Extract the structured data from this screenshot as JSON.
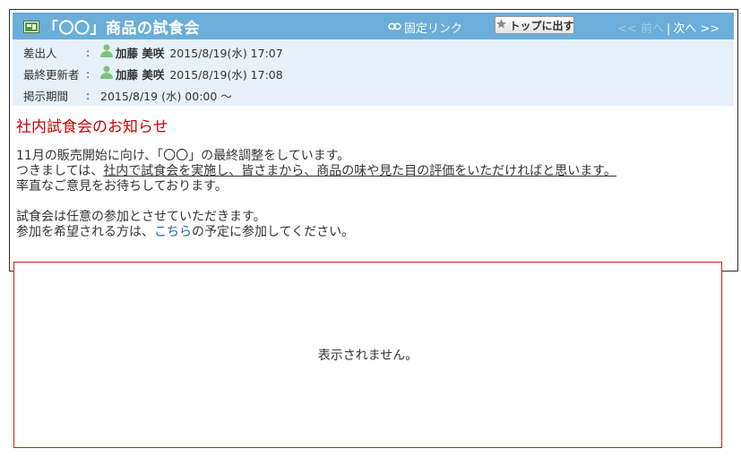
{
  "title_bar": {
    "title": "「〇〇」商品の試食会",
    "permalink_label": "固定リンク",
    "top_button_label": "トップに出す",
    "prev_label": "<< 前へ",
    "separator": "|",
    "next_label": "次へ >>",
    "icons": {
      "title": "notice-board-icon",
      "permalink": "link-icon",
      "top_button": "star-icon"
    },
    "colors": {
      "title_bar_bg": "#6aaed9",
      "meta_bg": "#e6f1f9"
    }
  },
  "meta": {
    "sender_label": "差出人",
    "sender_name": "加藤 美咲",
    "sender_datetime": "2015/8/19(水) 17:07",
    "updater_label": "最終更新者",
    "updater_name": "加藤 美咲",
    "updater_datetime": "2015/8/19(水) 17:08",
    "period_label": "掲示期間",
    "period_value": "2015/8/19 (水) 00:00 ～",
    "colon": ":"
  },
  "body": {
    "heading": "社内試食会のお知らせ",
    "line1": "11月の販売開始に向け、「〇〇」の最終調整をしています。",
    "line2_prefix": "つきましては、",
    "line2_underlined": "社内で試食会を実施し、皆さまから、商品の味や見た目の評価をいただければと思います。",
    "line3": "率直なご意見をお待ちしております。",
    "line4": "試食会は任意の参加とさせていただきます。",
    "line5_prefix": "参加を希望される方は、",
    "line5_link": "こちら",
    "line5_suffix": "の予定に参加してください。",
    "heading_color": "#cc0000",
    "link_color": "#1a6aa8"
  },
  "unavailable": {
    "message": "表示されません。",
    "border_color": "#d21a1a"
  }
}
